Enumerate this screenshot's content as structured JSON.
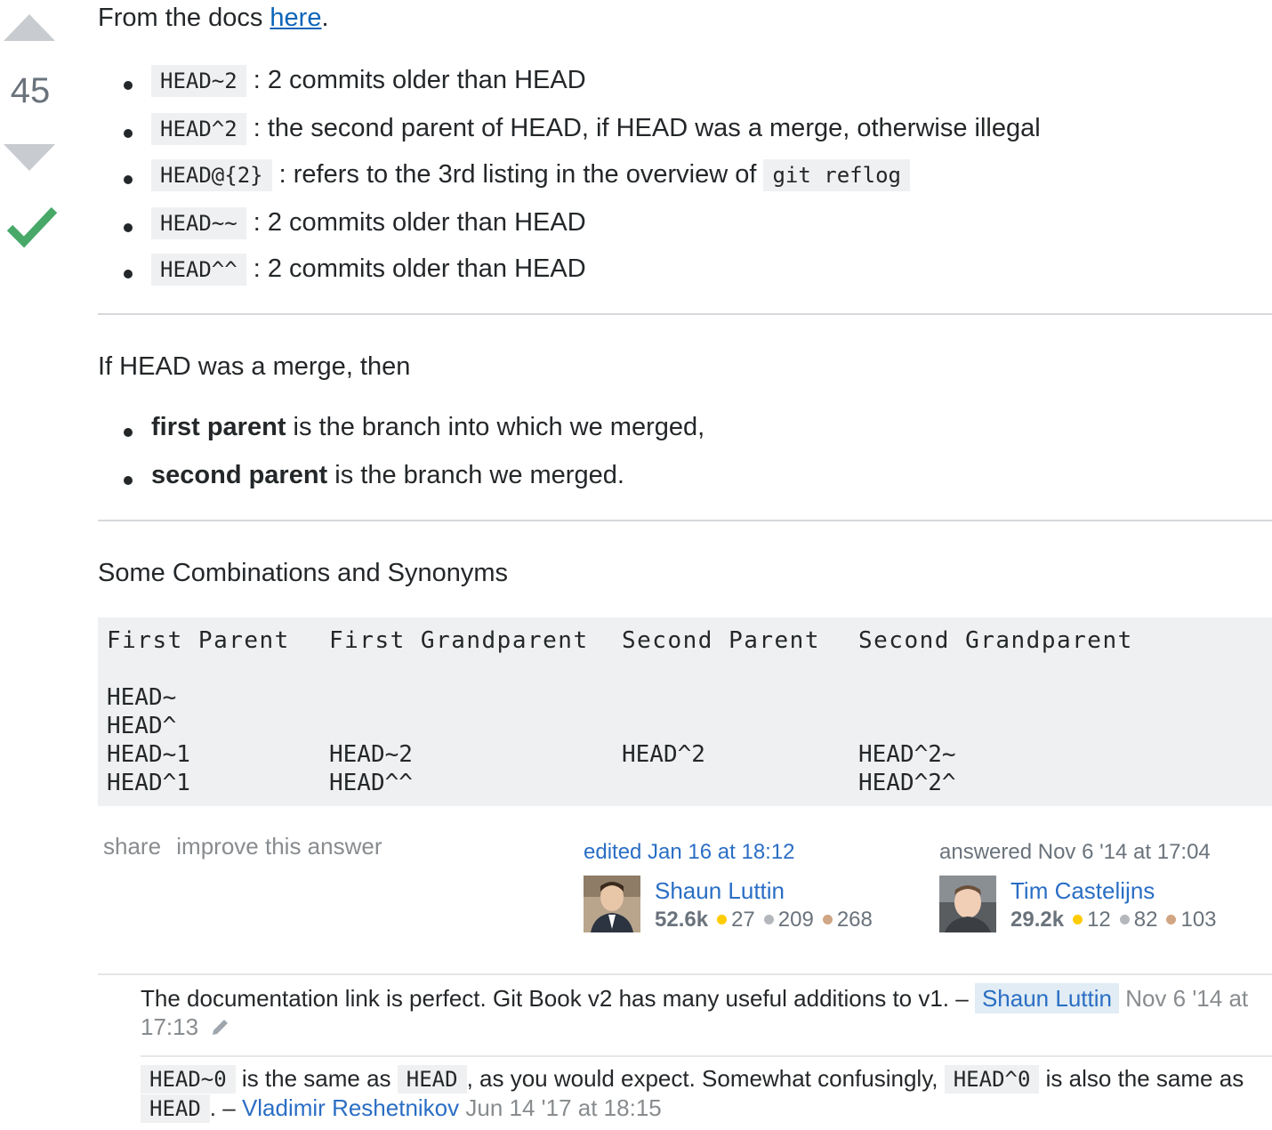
{
  "vote": {
    "count": "45"
  },
  "intro": {
    "prefix": "From the docs ",
    "link": "here",
    "suffix": "."
  },
  "list1": [
    {
      "code": "HEAD~2",
      "text": " : 2 commits older than HEAD"
    },
    {
      "code": "HEAD^2",
      "text": " : the second parent of HEAD, if HEAD was a merge, otherwise illegal"
    },
    {
      "code": "HEAD@{2}",
      "text": " : refers to the 3rd listing in the overview of ",
      "code2": "git reflog"
    },
    {
      "code": "HEAD~~",
      "text": " : 2 commits older than HEAD"
    },
    {
      "code": "HEAD^^",
      "text": " : 2 commits older than HEAD"
    }
  ],
  "merge_intro": "If HEAD was a merge, then",
  "list2": [
    {
      "bold": "first parent",
      "text": " is the branch into which we merged,"
    },
    {
      "bold": "second parent",
      "text": " is the branch we merged."
    }
  ],
  "combos_title": "Some Combinations and Synonyms",
  "table": {
    "headers": [
      "First Parent",
      "First Grandparent",
      "Second Parent",
      "Second Grandparent"
    ],
    "col1": "HEAD~\nHEAD^\nHEAD~1\nHEAD^1",
    "col2": "HEAD~2\nHEAD^^",
    "col3": "HEAD^2",
    "col4": "HEAD^2~\nHEAD^2^"
  },
  "menu": {
    "share": "share",
    "improve": "improve this answer"
  },
  "editor": {
    "action": "edited Jan 16 at 18:12",
    "name": "Shaun Luttin",
    "rep": "52.6k",
    "gold": "27",
    "silver": "209",
    "bronze": "268"
  },
  "answerer": {
    "action": "answered Nov 6 '14 at 17:04",
    "name": "Tim Castelijns",
    "rep": "29.2k",
    "gold": "12",
    "silver": "82",
    "bronze": "103"
  },
  "comments": [
    {
      "text": "The documentation link is perfect. Git Book v2 has many useful additions to v1. – ",
      "user": "Shaun Luttin",
      "date": " Nov 6 '14 at 17:13"
    },
    {
      "code_a": "HEAD~0",
      "t1": " is the same as ",
      "code_b": "HEAD",
      "t2": ", as you would expect. Somewhat confusingly, ",
      "code_c": "HEAD^0",
      "t3": " is also the same as ",
      "code_d": "HEAD",
      "t4": ". – ",
      "user": "Vladimir Reshetnikov",
      "date": " Jun 14 '17 at 18:15"
    }
  ],
  "colors": {
    "link": "#0c65b8",
    "accepted": "#48a868",
    "gold": "#ffcc01",
    "silver": "#b4b8bc",
    "bronze": "#d1a684"
  }
}
